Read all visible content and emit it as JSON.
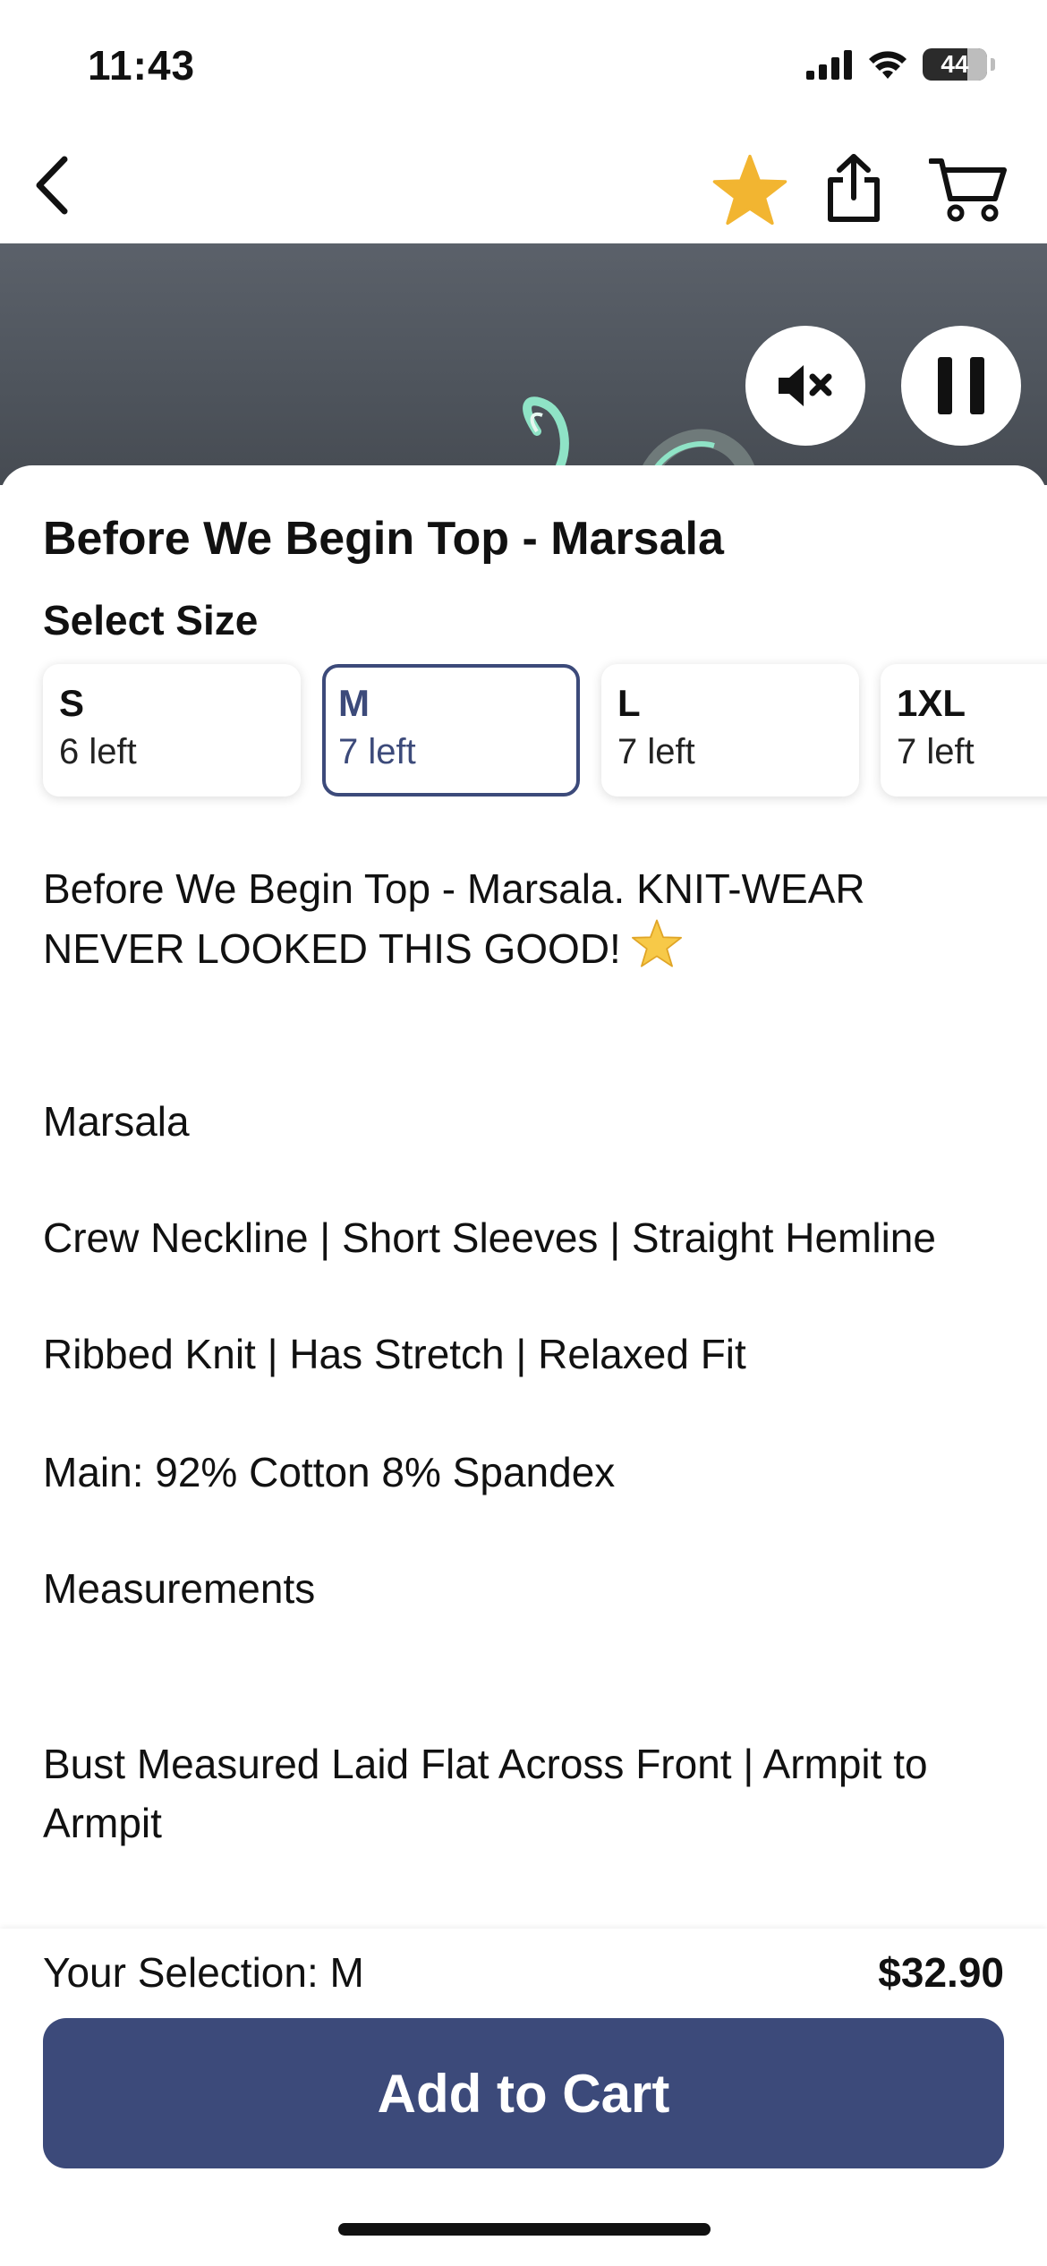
{
  "status_bar": {
    "time": "11:43",
    "battery": "44"
  },
  "nav": {
    "back_icon": "chevron-left-icon",
    "favorite_icon": "star-icon",
    "favorite_color": "#F2B531",
    "share_icon": "share-icon",
    "cart_icon": "cart-icon"
  },
  "media": {
    "mute_icon": "mute-icon",
    "pause_icon": "pause-icon"
  },
  "product": {
    "title": "Before We Begin Top - Marsala",
    "select_size_label": "Select Size",
    "sizes": [
      {
        "name": "S",
        "stock": "6 left",
        "selected": false
      },
      {
        "name": "M",
        "stock": "7 left",
        "selected": true
      },
      {
        "name": "L",
        "stock": "7 left",
        "selected": false
      },
      {
        "name": "1XL",
        "stock": "7 left",
        "selected": false
      }
    ],
    "description": {
      "intro": "Before We Begin Top - Marsala. KNIT-WEAR NEVER LOOKED THIS GOOD!",
      "intro_emoji": "⭐",
      "color": "Marsala",
      "style": "Crew Neckline | Short Sleeves | Straight Hemline",
      "fabric": "Ribbed Knit | Has Stretch | Relaxed Fit",
      "material": "Main: 92% Cotton 8% Spandex",
      "measurements_heading": "Measurements",
      "bust": "Bust Measured Laid Flat Across Front | Armpit to Armpit"
    }
  },
  "footer": {
    "selection": "Your Selection: M",
    "price": "$32.90",
    "add_to_cart": "Add to Cart"
  },
  "colors": {
    "accent": "#3C4A7A",
    "star": "#F2B531"
  }
}
